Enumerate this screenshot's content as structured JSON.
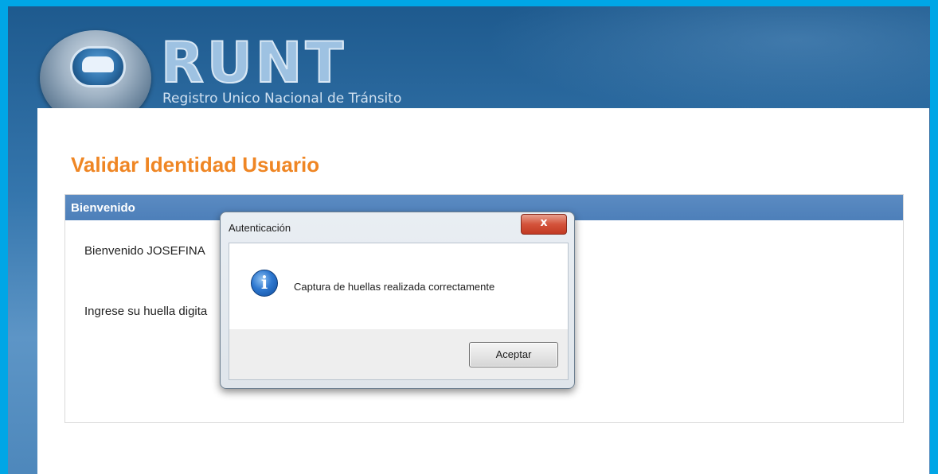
{
  "header": {
    "logo_text": "RUNT",
    "logo_subtitle": "Registro Unico Nacional de Tránsito"
  },
  "page": {
    "title": "Validar Identidad Usuario"
  },
  "panel": {
    "header": "Bienvenido",
    "welcome_text": "Bienvenido JOSEFINA",
    "fingerprint_prompt": "Ingrese su huella digita"
  },
  "dialog": {
    "title": "Autenticación",
    "close_glyph": "x",
    "icon": "info-icon",
    "icon_glyph": "i",
    "message": "Captura de huellas realizada correctamente",
    "accept_label": "Aceptar"
  },
  "colors": {
    "frame": "#00a6e6",
    "title_orange": "#ef8624",
    "panel_header": "#4d7fb9"
  }
}
